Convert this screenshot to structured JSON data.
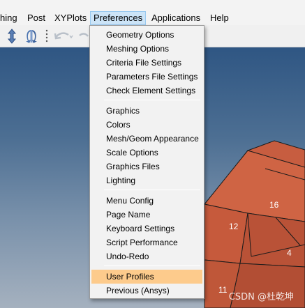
{
  "menubar": {
    "items": [
      "hing",
      "Post",
      "XYPlots",
      "Preferences",
      "Applications",
      "Help"
    ],
    "active": "Preferences"
  },
  "toolbar": {
    "icons": [
      "rotate-arrows-icon",
      "flip-icon",
      "separator-dots-icon",
      "undo-icon",
      "redo-icon"
    ]
  },
  "preferences_menu": {
    "groups": [
      [
        "Geometry Options",
        "Meshing Options",
        "Criteria File Settings",
        "Parameters File Settings",
        "Check Element Settings"
      ],
      [
        "Graphics",
        "Colors",
        "Mesh/Geom Appearance",
        "Scale Options",
        "Graphics Files",
        "Lighting"
      ],
      [
        "Menu Config",
        "Page Name",
        "Keyboard Settings",
        "Script Performance",
        "Undo-Redo"
      ],
      [
        "User Profiles",
        "Previous (Ansys)"
      ]
    ],
    "highlighted": "User Profiles"
  },
  "viewport": {
    "node_labels": [
      "16",
      "12",
      "4",
      "11"
    ],
    "element_color": "#c85a3c",
    "background_top": "#2f5683",
    "background_bottom": "#a5b1bf"
  },
  "watermark": "CSDN @杜乾坤"
}
